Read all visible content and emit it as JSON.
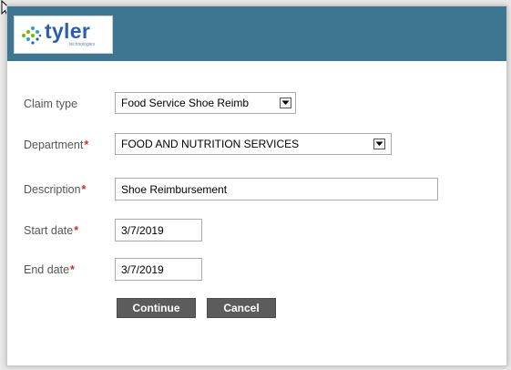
{
  "brand": {
    "name": "tyler",
    "tagline": "technologies",
    "header_color": "#3e7591",
    "logo_color": "#2b5fa8"
  },
  "form": {
    "claim_type": {
      "label": "Claim type",
      "value": "Food Service Shoe Reimb"
    },
    "department": {
      "label": "Department",
      "value": "FOOD AND NUTRITION SERVICES"
    },
    "description": {
      "label": "Description",
      "value": "Shoe Reimbursement"
    },
    "start_date": {
      "label": "Start date",
      "value": "3/7/2019"
    },
    "end_date": {
      "label": "End date",
      "value": "3/7/2019"
    },
    "required_marker": "*"
  },
  "buttons": {
    "continue": "Continue",
    "cancel": "Cancel"
  },
  "colors": {
    "required": "#d22b2b",
    "button": "#5c5c5c"
  }
}
